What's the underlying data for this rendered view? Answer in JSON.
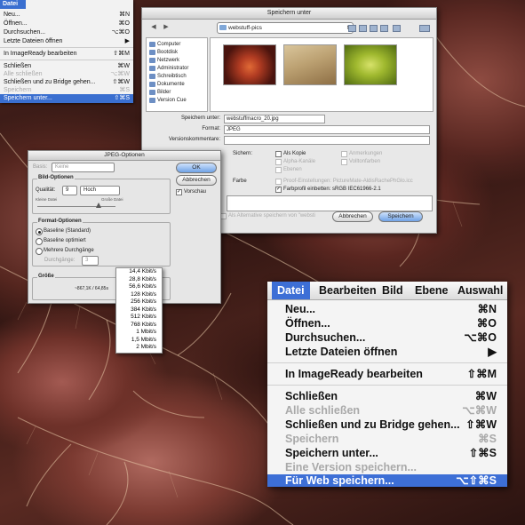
{
  "small_menu": {
    "title": "Datei",
    "items": [
      {
        "label": "Neu...",
        "shortcut": "⌘N",
        "state": "normal"
      },
      {
        "label": "Öffnen...",
        "shortcut": "⌘O",
        "state": "normal"
      },
      {
        "label": "Durchsuchen...",
        "shortcut": "⌥⌘O",
        "state": "normal"
      },
      {
        "label": "Letzte Dateien öffnen",
        "shortcut": "▶",
        "state": "normal"
      },
      {
        "label": "In ImageReady bearbeiten",
        "shortcut": "⇧⌘M",
        "state": "normal"
      },
      {
        "label": "Schließen",
        "shortcut": "⌘W",
        "state": "normal"
      },
      {
        "label": "Alle schließen",
        "shortcut": "⌥⌘W",
        "state": "disabled"
      },
      {
        "label": "Schließen und zu Bridge gehen...",
        "shortcut": "⇧⌘W",
        "state": "normal"
      },
      {
        "label": "Speichern",
        "shortcut": "⌘S",
        "state": "disabled"
      },
      {
        "label": "Speichern unter...",
        "shortcut": "⇧⌘S",
        "state": "highlighted"
      }
    ]
  },
  "save_dialog": {
    "title": "Speichern unter",
    "folder": "webstuff-pics",
    "sidebar": [
      "Computer",
      "Bootdisk",
      "Netzwerk",
      "Administrator",
      "Schreibtisch",
      "Dokumente",
      "Bilder",
      "Version Cue"
    ],
    "save_as_label": "Speichern unter:",
    "save_as_value": "webstuffmacro_20.jpg",
    "format_label": "Format:",
    "format_value": "JPEG",
    "comments_label": "Versionskommentare:",
    "save_section": "Sichern:",
    "color_section": "Farbe",
    "opt_copy": "Als Kopie",
    "opt_notes": "Anmerkungen",
    "opt_alpha": "Alpha-Kanäle",
    "opt_spot": "Volltonfarben",
    "opt_layers": "Ebenen",
    "opt_proof": "Proof-Einstellungen: PictureMate-AldisRachePhGlo.icc",
    "opt_profile": "Farbprofil einbetten: sRGB IEC61966-2.1",
    "alt_save": "Als Alternative speichern von \"websti",
    "cancel": "Abbrechen",
    "save": "Speichern"
  },
  "jpeg_dialog": {
    "title": "JPEG-Optionen",
    "basis_label": "Basis:",
    "basis_value": "Keine",
    "image_options": "Bild-Optionen",
    "quality_label": "Qualität:",
    "quality_value": "9",
    "quality_level": "Hoch",
    "small_file": "Kleine Datei",
    "large_file": "Große Datei",
    "ok": "OK",
    "cancel": "Abbrechen",
    "preview": "Vorschau",
    "format_options": "Format-Optionen",
    "fmt_baseline": "Baseline (Standard)",
    "fmt_optimized": "Baseline optimiert",
    "fmt_progressive": "Mehrere Durchgänge",
    "passes_label": "Durchgänge:",
    "passes_value": "3",
    "size_label": "Größe",
    "size_value": "~867,1K / 64,85s",
    "speeds": [
      "14,4 Kbit/s",
      "28,8 Kbit/s",
      "56,6 Kbit/s",
      "128 Kbit/s",
      "256 Kbit/s",
      "384 Kbit/s",
      "512 Kbit/s",
      "768 Kbit/s",
      "1 Mbit/s",
      "1,5 Mbit/s",
      "2 Mbit/s"
    ]
  },
  "big_menu": {
    "bar": [
      "Datei",
      "Bearbeiten",
      "Bild",
      "Ebene",
      "Auswahl"
    ],
    "items": [
      {
        "label": "Neu...",
        "shortcut": "⌘N",
        "state": "normal"
      },
      {
        "label": "Öffnen...",
        "shortcut": "⌘O",
        "state": "normal"
      },
      {
        "label": "Durchsuchen...",
        "shortcut": "⌥⌘O",
        "state": "normal"
      },
      {
        "label": "Letzte Dateien öffnen",
        "shortcut": "▶",
        "state": "normal"
      },
      {
        "label": "In ImageReady bearbeiten",
        "shortcut": "⇧⌘M",
        "state": "normal"
      },
      {
        "label": "Schließen",
        "shortcut": "⌘W",
        "state": "normal"
      },
      {
        "label": "Alle schließen",
        "shortcut": "⌥⌘W",
        "state": "disabled"
      },
      {
        "label": "Schließen und zu Bridge gehen...",
        "shortcut": "⇧⌘W",
        "state": "normal"
      },
      {
        "label": "Speichern",
        "shortcut": "⌘S",
        "state": "disabled"
      },
      {
        "label": "Speichern unter...",
        "shortcut": "⇧⌘S",
        "state": "normal"
      },
      {
        "label": "Eine Version speichern...",
        "shortcut": "",
        "state": "disabled"
      },
      {
        "label": "Für Web speichern...",
        "shortcut": "⌥⇧⌘S",
        "state": "highlighted"
      }
    ]
  },
  "colors": {
    "accent": "#3d6fd6",
    "menu_bg": "#f4f4f4",
    "disabled": "#a9a9a9"
  }
}
